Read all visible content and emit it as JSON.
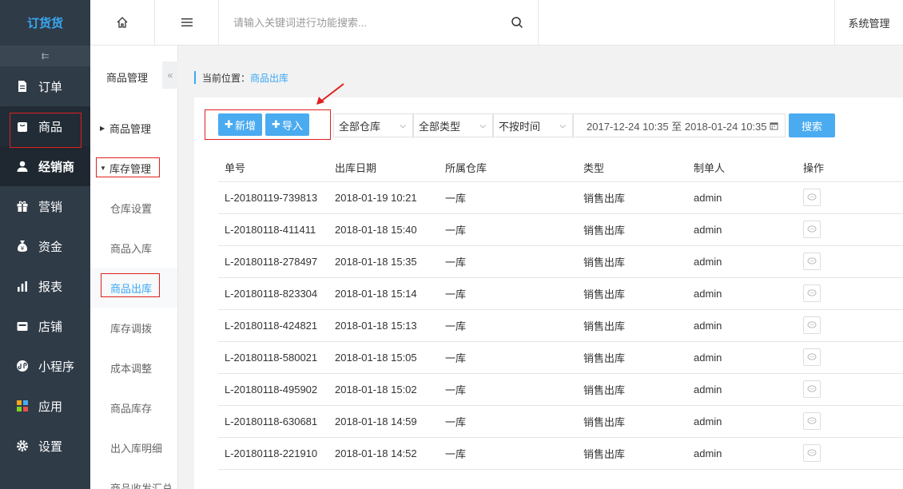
{
  "app": {
    "logo": "订货货",
    "collapse_glyph": "⇇"
  },
  "nav": [
    {
      "label": "订单",
      "icon": "document-icon"
    },
    {
      "label": "商品",
      "icon": "bag-icon"
    },
    {
      "label": "经销商",
      "icon": "user-icon"
    },
    {
      "label": "营销",
      "icon": "gift-icon"
    },
    {
      "label": "资金",
      "icon": "money-icon"
    },
    {
      "label": "报表",
      "icon": "bar-chart-icon"
    },
    {
      "label": "店铺",
      "icon": "shop-icon"
    },
    {
      "label": "小程序",
      "icon": "miniapp-icon"
    },
    {
      "label": "应用",
      "icon": "apps-icon"
    },
    {
      "label": "设置",
      "icon": "gear-icon"
    }
  ],
  "topbar": {
    "search_placeholder": "请输入关键词进行功能搜索...",
    "system": "系统管理"
  },
  "subnav": {
    "title": "商品管理",
    "items": [
      {
        "label": "商品管理",
        "type": "group",
        "expanded": false
      },
      {
        "label": "库存管理",
        "type": "group",
        "expanded": true
      },
      {
        "label": "仓库设置",
        "type": "item"
      },
      {
        "label": "商品入库",
        "type": "item"
      },
      {
        "label": "商品出库",
        "type": "item",
        "current": true
      },
      {
        "label": "库存调拨",
        "type": "item"
      },
      {
        "label": "成本调整",
        "type": "item"
      },
      {
        "label": "商品库存",
        "type": "item"
      },
      {
        "label": "出入库明细",
        "type": "item"
      },
      {
        "label": "商品收发汇总",
        "type": "item"
      }
    ]
  },
  "breadcrumb": {
    "prefix": "当前位置：",
    "current": "商品出库"
  },
  "toolbar": {
    "add_label": "新增",
    "import_label": "导入",
    "warehouse": "全部仓库",
    "type": "全部类型",
    "time": "不按时间",
    "date_range": "2017-12-24 10:35 至 2018-01-24 10:35",
    "search_label": "搜索"
  },
  "table": {
    "headers": [
      "单号",
      "出库日期",
      "所属仓库",
      "类型",
      "制单人",
      "操作"
    ],
    "rows": [
      [
        "L-20180119-739813",
        "2018-01-19 10:21",
        "一库",
        "销售出库",
        "admin"
      ],
      [
        "L-20180118-411411",
        "2018-01-18 15:40",
        "一库",
        "销售出库",
        "admin"
      ],
      [
        "L-20180118-278497",
        "2018-01-18 15:35",
        "一库",
        "销售出库",
        "admin"
      ],
      [
        "L-20180118-823304",
        "2018-01-18 15:14",
        "一库",
        "销售出库",
        "admin"
      ],
      [
        "L-20180118-424821",
        "2018-01-18 15:13",
        "一库",
        "销售出库",
        "admin"
      ],
      [
        "L-20180118-580021",
        "2018-01-18 15:05",
        "一库",
        "销售出库",
        "admin"
      ],
      [
        "L-20180118-495902",
        "2018-01-18 15:02",
        "一库",
        "销售出库",
        "admin"
      ],
      [
        "L-20180118-630681",
        "2018-01-18 14:59",
        "一库",
        "销售出库",
        "admin"
      ],
      [
        "L-20180118-221910",
        "2018-01-18 14:52",
        "一库",
        "销售出库",
        "admin"
      ]
    ]
  },
  "colors": {
    "accent": "#3aa8f4",
    "nav_bg": "#2f3b47",
    "annotation": "#e02020"
  }
}
